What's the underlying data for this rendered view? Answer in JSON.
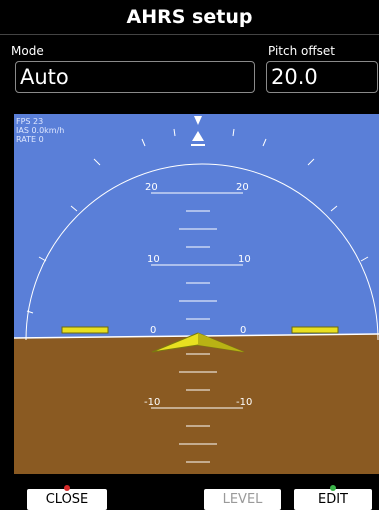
{
  "window": {
    "title": "AHRS setup"
  },
  "fields": {
    "mode": {
      "label": "Mode",
      "value": "Auto"
    },
    "pitch_offset": {
      "label": "Pitch offset",
      "value": "20.0"
    }
  },
  "status": {
    "fps": "FPS 23",
    "ias": "IAS 0.0km/h",
    "rate": "RATE 0"
  },
  "pitch_ladder": {
    "labels": [
      "20",
      "10",
      "0",
      "-10"
    ]
  },
  "softkeys": {
    "close": "CLOSE",
    "level": "LEVEL",
    "edit": "EDIT"
  },
  "colors": {
    "sky": "#5a7fd8",
    "ground": "#8a5a22",
    "symbol": "#e8e020",
    "close_indicator": "#d62a2a",
    "edit_indicator": "#3bb54a"
  },
  "icons": {
    "roll_pointer": "white-triangle",
    "aircraft_symbol": "yellow-chevron",
    "wing_marks": "yellow-bars"
  }
}
